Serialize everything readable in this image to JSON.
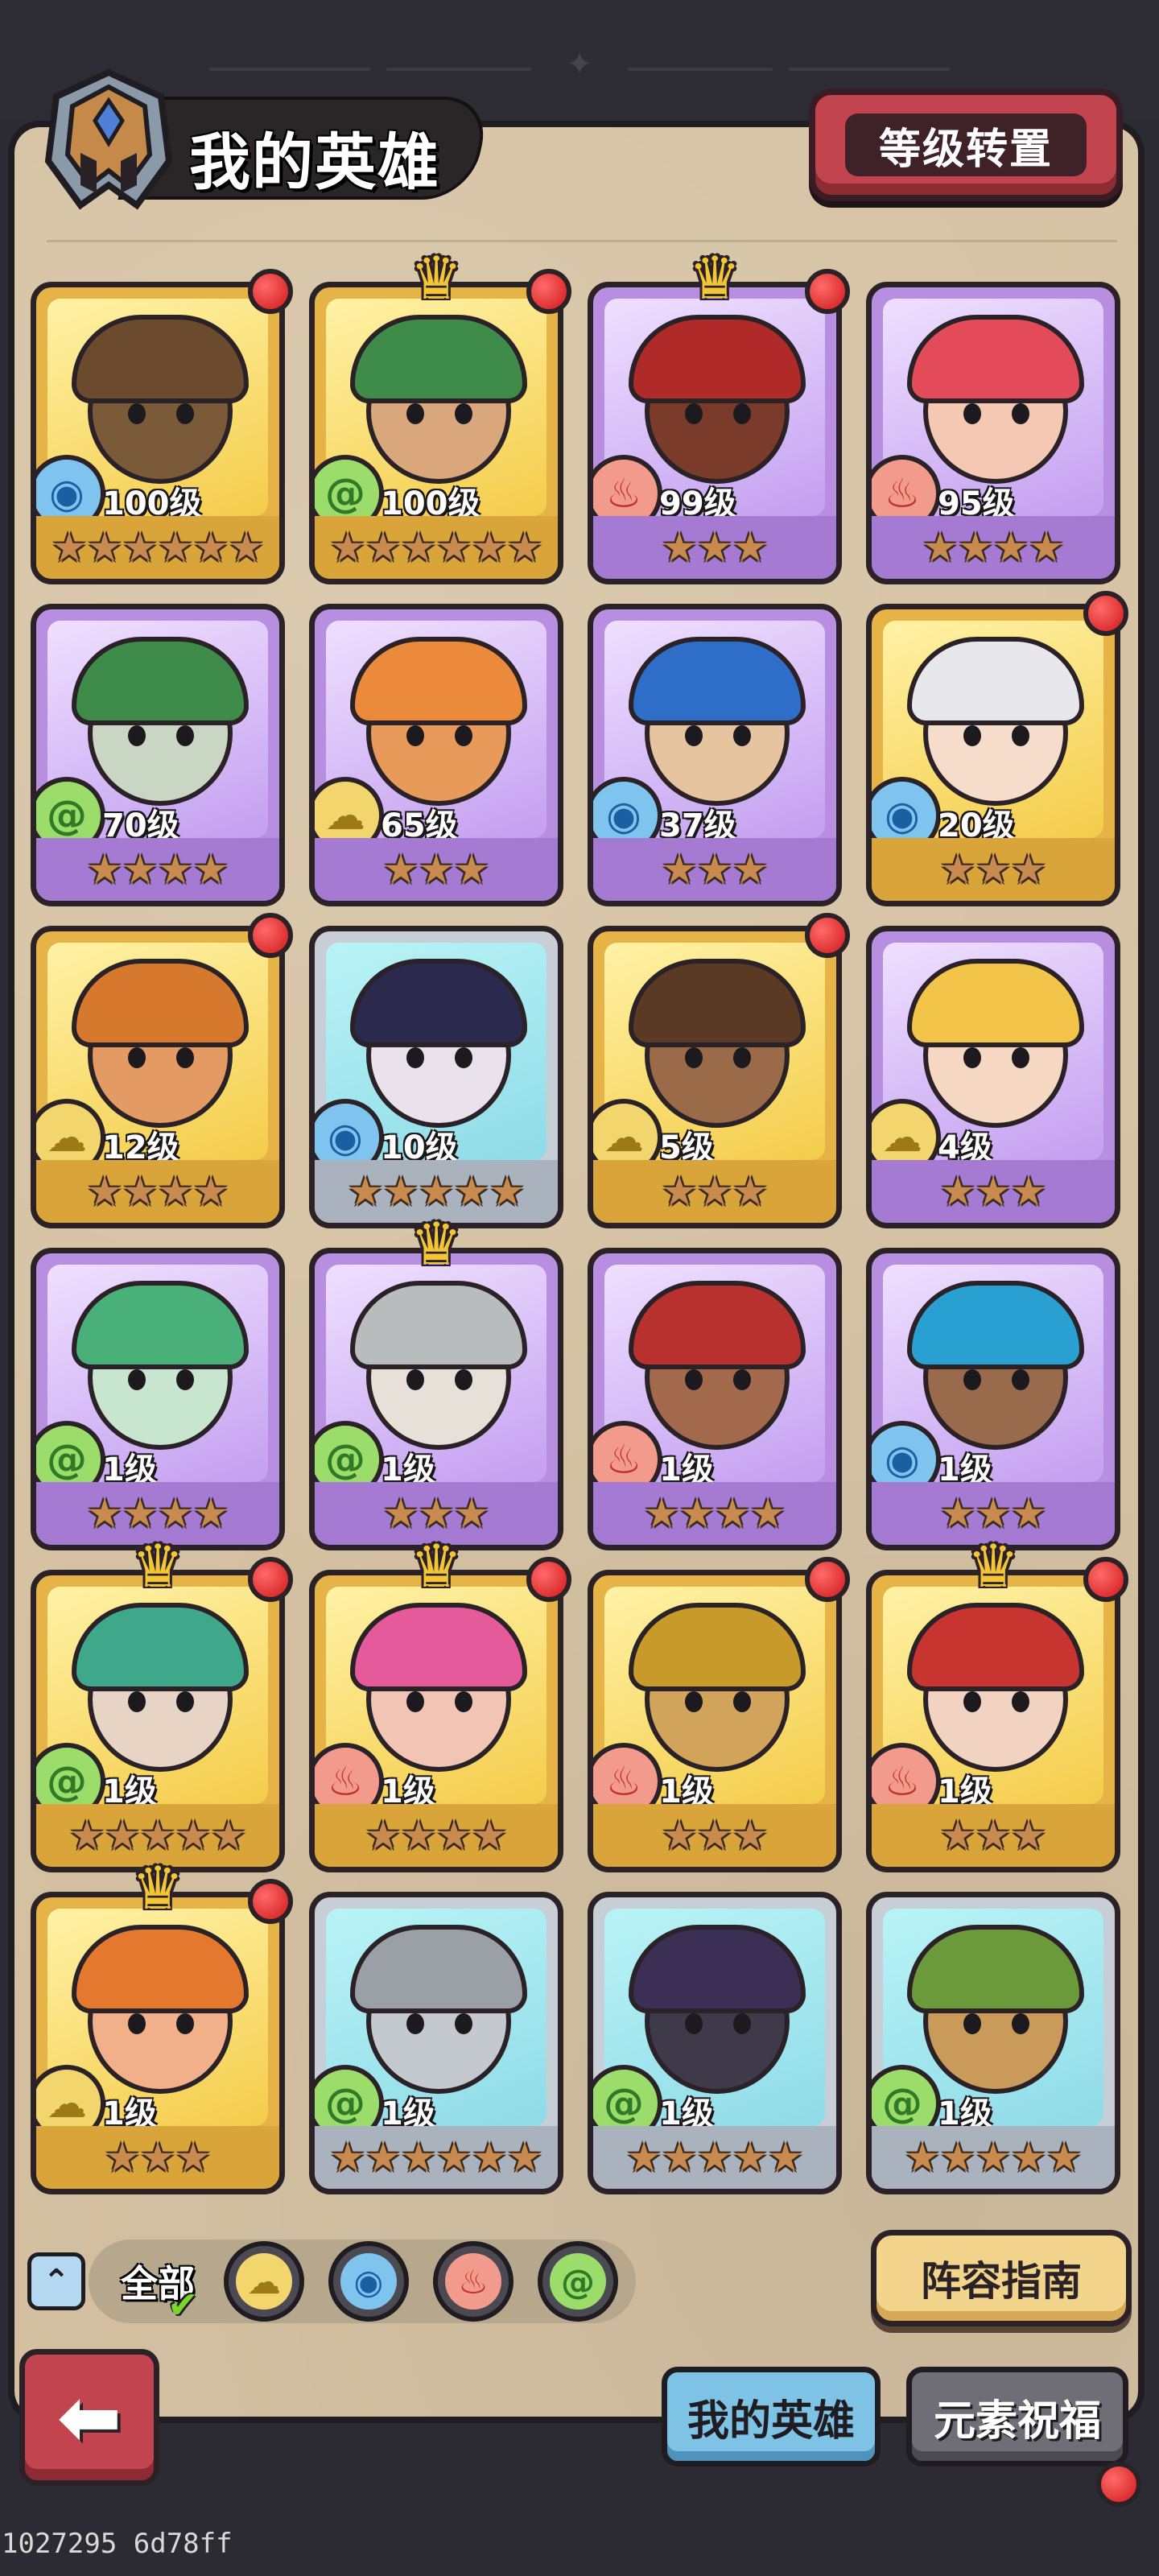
{
  "header": {
    "title": "我的英雄",
    "transfer_label": "等级转置"
  },
  "heroes": [
    {
      "level": "100级",
      "element": "water",
      "stars": 6,
      "frame": "gold",
      "crown": false,
      "dot": true
    },
    {
      "level": "100级",
      "element": "wind",
      "stars": 6,
      "frame": "gold",
      "crown": true,
      "dot": true
    },
    {
      "level": "99级",
      "element": "fire",
      "stars": 3,
      "frame": "purple",
      "crown": true,
      "dot": true
    },
    {
      "level": "95级",
      "element": "fire",
      "stars": 4,
      "frame": "purple",
      "crown": false,
      "dot": false
    },
    {
      "level": "70级",
      "element": "wind",
      "stars": 4,
      "frame": "purple",
      "crown": false,
      "dot": false
    },
    {
      "level": "65级",
      "element": "earth",
      "stars": 3,
      "frame": "purple",
      "crown": false,
      "dot": false
    },
    {
      "level": "37级",
      "element": "water",
      "stars": 3,
      "frame": "purple",
      "crown": false,
      "dot": false
    },
    {
      "level": "20级",
      "element": "water",
      "stars": 3,
      "frame": "gold",
      "crown": false,
      "dot": true
    },
    {
      "level": "12级",
      "element": "earth",
      "stars": 4,
      "frame": "gold",
      "crown": false,
      "dot": true
    },
    {
      "level": "10级",
      "element": "water",
      "stars": 5,
      "frame": "silver",
      "crown": false,
      "dot": false
    },
    {
      "level": "5级",
      "element": "earth",
      "stars": 3,
      "frame": "gold",
      "crown": false,
      "dot": true
    },
    {
      "level": "4级",
      "element": "earth",
      "stars": 3,
      "frame": "purple",
      "crown": false,
      "dot": false
    },
    {
      "level": "1级",
      "element": "wind",
      "stars": 4,
      "frame": "purple",
      "crown": false,
      "dot": false
    },
    {
      "level": "1级",
      "element": "wind",
      "stars": 3,
      "frame": "purple",
      "crown": true,
      "dot": false
    },
    {
      "level": "1级",
      "element": "fire",
      "stars": 4,
      "frame": "purple",
      "crown": false,
      "dot": false
    },
    {
      "level": "1级",
      "element": "water",
      "stars": 3,
      "frame": "purple",
      "crown": false,
      "dot": false
    },
    {
      "level": "1级",
      "element": "wind",
      "stars": 5,
      "frame": "gold",
      "crown": true,
      "dot": true
    },
    {
      "level": "1级",
      "element": "fire",
      "stars": 4,
      "frame": "gold",
      "crown": true,
      "dot": true
    },
    {
      "level": "1级",
      "element": "fire",
      "stars": 3,
      "frame": "gold",
      "crown": false,
      "dot": true
    },
    {
      "level": "1级",
      "element": "fire",
      "stars": 3,
      "frame": "gold",
      "crown": true,
      "dot": true
    },
    {
      "level": "1级",
      "element": "earth",
      "stars": 3,
      "frame": "gold",
      "crown": true,
      "dot": true
    },
    {
      "level": "1级",
      "element": "wind",
      "stars": 6,
      "frame": "silver",
      "crown": false,
      "dot": false
    },
    {
      "level": "1级",
      "element": "wind",
      "stars": 5,
      "frame": "silver",
      "crown": false,
      "dot": false
    },
    {
      "level": "1级",
      "element": "wind",
      "stars": 5,
      "frame": "silver",
      "crown": false,
      "dot": false
    }
  ],
  "filter": {
    "all_label": "全部",
    "elements": [
      "earth",
      "water",
      "fire",
      "wind"
    ]
  },
  "guide_label": "阵容指南",
  "tabs": {
    "my_heroes": "我的英雄",
    "element_blessing": "元素祝福"
  },
  "footer": "1027295 6d78ff",
  "colors": {
    "water": "#1b5fa3",
    "wind": "#2e7a27",
    "fire": "#c0312f",
    "earth": "#9c7a18"
  },
  "icons": {
    "water": "water-drop-icon",
    "wind": "wind-swirl-icon",
    "fire": "fire-icon",
    "earth": "earth-cloud-icon"
  }
}
